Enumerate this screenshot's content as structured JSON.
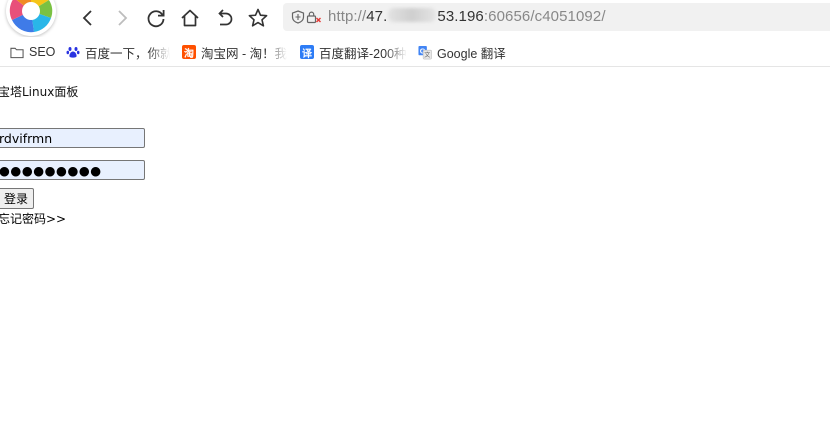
{
  "toolbar": {
    "url": {
      "scheme": "http://",
      "host_start": "47.",
      "host_end": "53.196",
      "rest": ":60656/c4051092/"
    }
  },
  "bookmarks": [
    {
      "label": "SEO",
      "icon": "folder-icon"
    },
    {
      "label": "百度一下，你就",
      "icon": "baidu-paw-icon"
    },
    {
      "label": "淘宝网 - 淘！我",
      "icon": "taobao-icon"
    },
    {
      "label": "百度翻译-200种",
      "icon": "baidu-translate-icon"
    },
    {
      "label": "Google 翻译",
      "icon": "google-translate-icon"
    }
  ],
  "page": {
    "title": "宝塔Linux面板",
    "username_value": "rdvifrmn",
    "password_value": "●●●●●●●●●",
    "login_label": "登录",
    "forgot_label": "忘记密码>>"
  },
  "colors": {
    "input_autofill_bg": "#e8f0fe",
    "address_bar_bg": "#f1f1f1",
    "taobao_orange": "#ff5000",
    "baidu_blue": "#2932e1",
    "translate_blue": "#2d7cf6",
    "google_blue": "#4285f4"
  }
}
